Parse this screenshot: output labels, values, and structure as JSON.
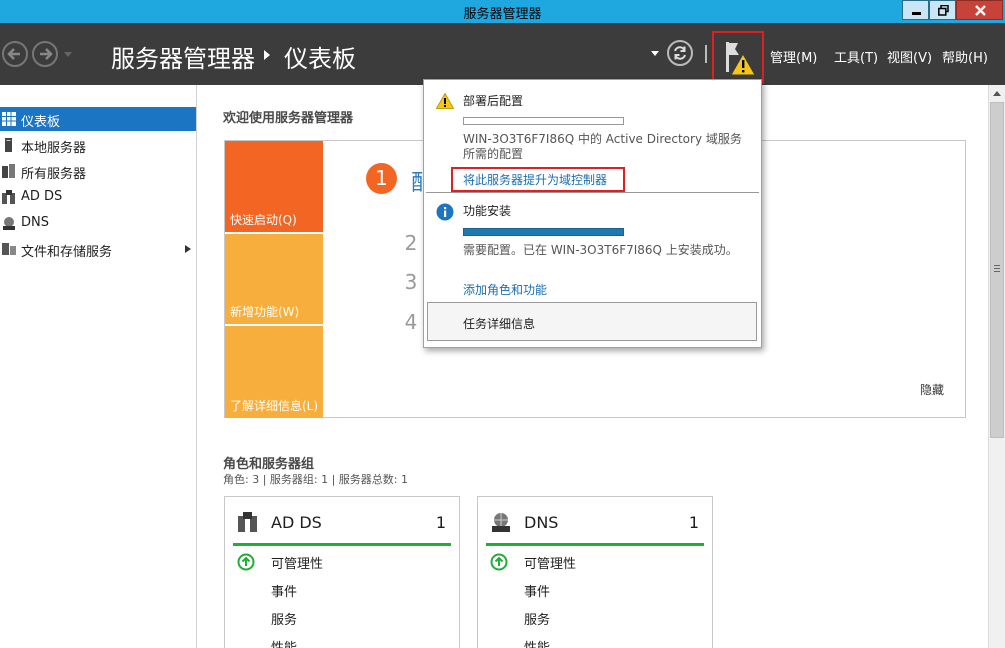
{
  "window": {
    "title": "服务器管理器"
  },
  "header": {
    "app_title": "服务器管理器",
    "page_title": "仪表板",
    "menus": [
      "管理(M)",
      "工具(T)",
      "视图(V)",
      "帮助(H)"
    ]
  },
  "sidebar": {
    "items": [
      {
        "label": "仪表板",
        "icon": "dashboard-icon",
        "active": true
      },
      {
        "label": "本地服务器",
        "icon": "server-icon"
      },
      {
        "label": "所有服务器",
        "icon": "servers-icon"
      },
      {
        "label": "AD DS",
        "icon": "ad-ds-icon"
      },
      {
        "label": "DNS",
        "icon": "dns-icon"
      },
      {
        "label": "文件和存储服务",
        "icon": "storage-icon",
        "has_submenu": true
      }
    ]
  },
  "welcome": {
    "title": "欢迎使用服务器管理器",
    "tiles": [
      "快速启动(Q)",
      "新增功能(W)",
      "了解详细信息(L)"
    ],
    "step1_number": "1",
    "step1_text": "配",
    "step_numbers": [
      "2",
      "3",
      "4"
    ],
    "hide_label": "隐藏"
  },
  "roles": {
    "title": "角色和服务器组",
    "summary": "角色: 3 | 服务器组: 1 | 服务器总数: 1",
    "cards": [
      {
        "name": "AD DS",
        "count": "1",
        "rows": [
          "可管理性",
          "事件",
          "服务",
          "性能"
        ]
      },
      {
        "name": "DNS",
        "count": "1",
        "rows": [
          "可管理性",
          "事件",
          "服务",
          "性能"
        ]
      }
    ]
  },
  "notifications": {
    "item1": {
      "title": "部署后配置",
      "progress": 0,
      "description": "WIN-3O3T6F7I86Q 中的 Active Directory 域服务所需的配置",
      "link": "将此服务器提升为域控制器"
    },
    "item2": {
      "title": "功能安装",
      "progress": 1.0,
      "description": "需要配置。已在 WIN-3O3T6F7I86Q 上安装成功。",
      "link": "添加角色和功能"
    },
    "task_details": "任务详细信息"
  },
  "colors": {
    "accent_blue": "#1c75c3",
    "header_bg": "#3c3c3c",
    "titlebar_bg": "#1fa8e0",
    "tile_orange": "#f26522",
    "tile_yellow": "#f8ae3c",
    "status_green": "#1fae36",
    "highlight_red": "#e02020"
  }
}
